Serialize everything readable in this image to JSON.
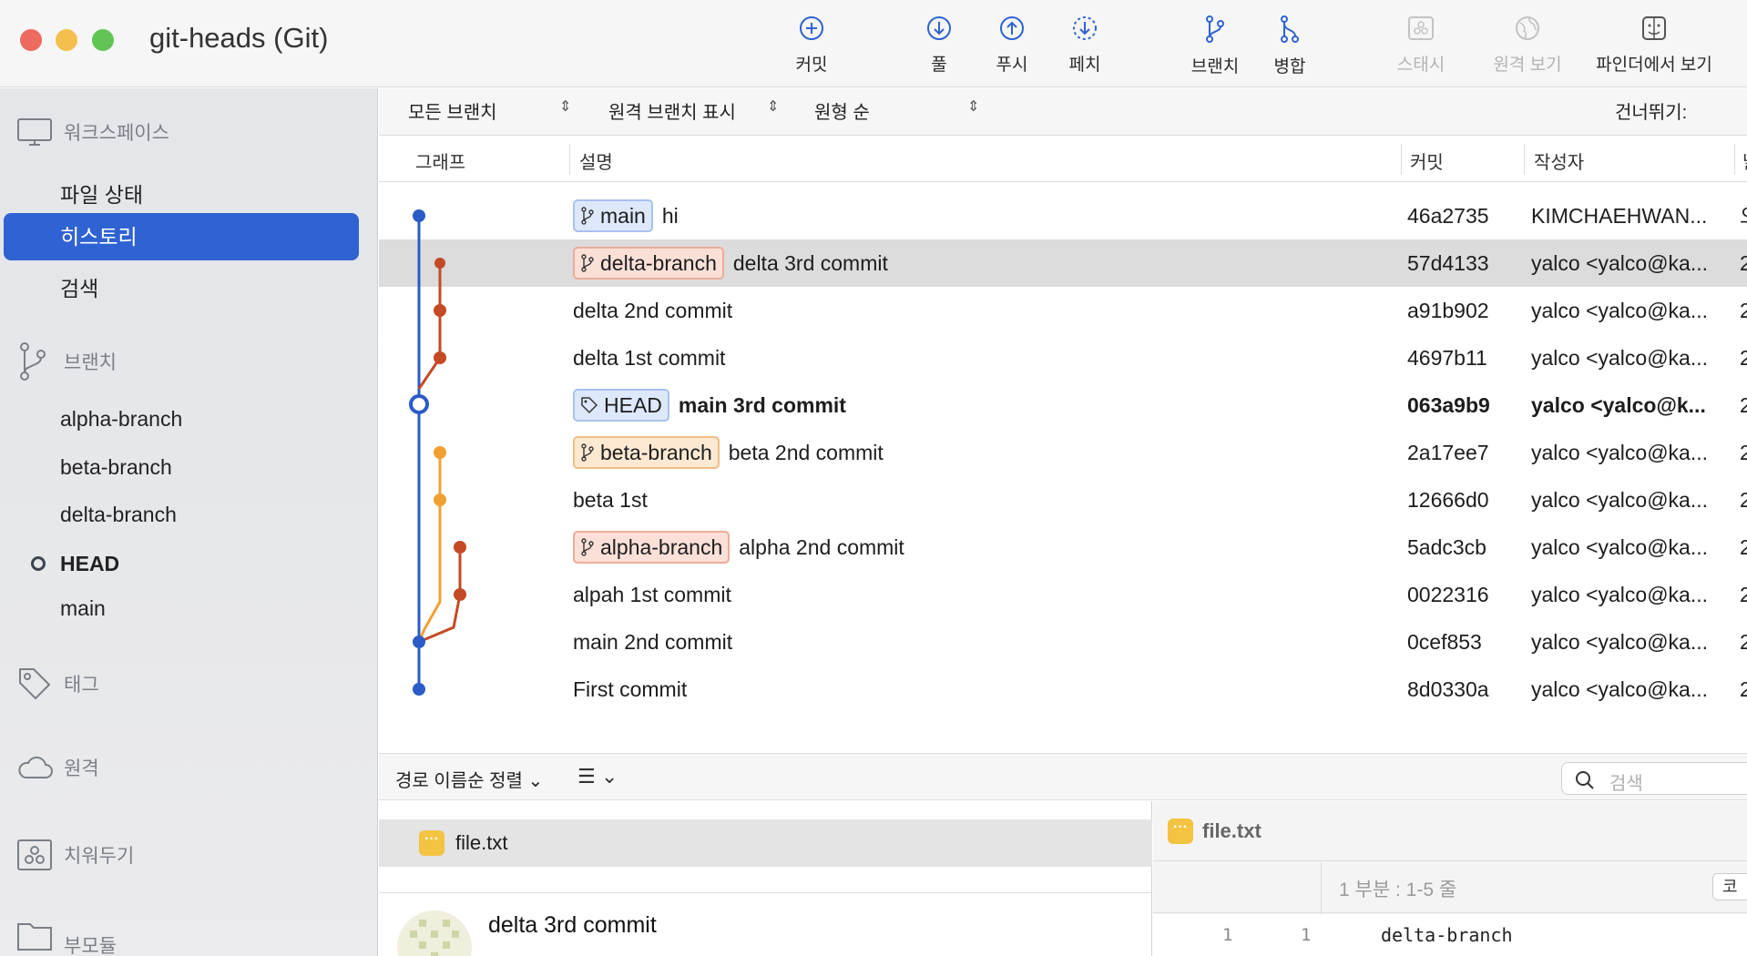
{
  "window": {
    "title": "git-heads (Git)"
  },
  "toolbar": {
    "commit": "커밋",
    "pull": "풀",
    "push": "푸시",
    "fetch": "페치",
    "branch": "브랜치",
    "merge": "병합",
    "stash": "스태시",
    "remote": "원격 보기",
    "finder": "파인더에서 보기"
  },
  "sidebar": {
    "workspace": "워크스페이스",
    "workspace_items": [
      "파일 상태",
      "히스토리",
      "검색"
    ],
    "selected_item": "히스토리",
    "branches": "브랜치",
    "branch_items": [
      "alpha-branch",
      "beta-branch",
      "delta-branch",
      "HEAD",
      "main"
    ],
    "current_branch": "HEAD",
    "tags": "태그",
    "remotes": "원격",
    "stashes": "치워두기",
    "submodules": "부모듈"
  },
  "filters": {
    "branches": "모든 브랜치",
    "remote": "원격 브랜치 표시",
    "order": "원형 순",
    "skip": "건너뛰기:"
  },
  "columns": {
    "graph": "그래프",
    "description": "설명",
    "commit": "커밋",
    "author": "작성자",
    "date_cut": "날"
  },
  "commits": [
    {
      "badge": "main",
      "badge_type": "main",
      "message": "hi",
      "hash": "46a2735",
      "author": "KIMCHAEHWAN...",
      "date_cut": "오"
    },
    {
      "badge": "delta-branch",
      "badge_type": "delta",
      "message": "delta 3rd commit",
      "hash": "57d4133",
      "author": "yalco <yalco@ka...",
      "date_cut": "2"
    },
    {
      "badge": "",
      "badge_type": "",
      "message": "delta 2nd commit",
      "hash": "a91b902",
      "author": "yalco <yalco@ka...",
      "date_cut": "2"
    },
    {
      "badge": "",
      "badge_type": "",
      "message": "delta 1st commit",
      "hash": "4697b11",
      "author": "yalco <yalco@ka...",
      "date_cut": "2"
    },
    {
      "badge": "HEAD",
      "badge_type": "head",
      "message": "main 3rd commit",
      "hash": "063a9b9",
      "author": "yalco <yalco@k...",
      "date_cut": "2"
    },
    {
      "badge": "beta-branch",
      "badge_type": "beta",
      "message": "beta 2nd commit",
      "hash": "2a17ee7",
      "author": "yalco <yalco@ka...",
      "date_cut": "2"
    },
    {
      "badge": "",
      "badge_type": "",
      "message": "beta 1st",
      "hash": "12666d0",
      "author": "yalco <yalco@ka...",
      "date_cut": "2"
    },
    {
      "badge": "alpha-branch",
      "badge_type": "alpha",
      "message": "alpha 2nd commit",
      "hash": "5adc3cb",
      "author": "yalco <yalco@ka...",
      "date_cut": "2"
    },
    {
      "badge": "",
      "badge_type": "",
      "message": "alpah 1st commit",
      "hash": "0022316",
      "author": "yalco <yalco@ka...",
      "date_cut": "2"
    },
    {
      "badge": "",
      "badge_type": "",
      "message": "main 2nd commit",
      "hash": "0cef853",
      "author": "yalco <yalco@ka...",
      "date_cut": "2"
    },
    {
      "badge": "",
      "badge_type": "",
      "message": "First commit",
      "hash": "8d0330a",
      "author": "yalco <yalco@ka...",
      "date_cut": "2"
    }
  ],
  "selected_commit": "57d4133",
  "head_commit": "063a9b9",
  "colors": {
    "main": "#2a5bc6",
    "delta": "#c44a25",
    "beta": "#f0a033",
    "alpha": "#c44a25",
    "selection": "#2f62d2"
  },
  "bottom": {
    "sort": "경로 이름순 정렬",
    "list_icon": "list-icon",
    "search_placeholder": "검색"
  },
  "files": {
    "name": "file.txt"
  },
  "detail": {
    "message": "delta 3rd commit"
  },
  "diff": {
    "file": "file.txt",
    "hunk": "1 부분 : 1-5 줄",
    "copy": "코",
    "old_line": "1",
    "new_line": "1",
    "code": "delta-branch"
  }
}
